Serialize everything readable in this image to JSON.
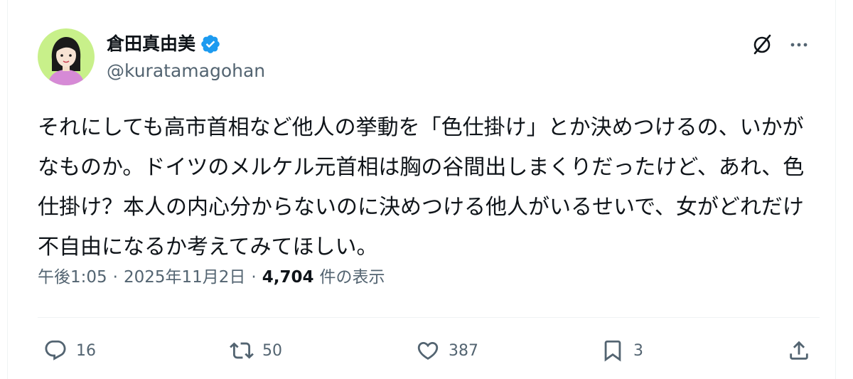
{
  "author": {
    "display_name": "倉田真由美",
    "handle": "@kuratamagohan",
    "verified": true
  },
  "tweet": {
    "text": "それにしても高市首相など他人の挙動を「色仕掛け」とか決めつけるの、いかがなものか。ドイツのメルケル元首相は胸の谷間出しまくりだったけど、あれ、色仕掛け？本人の内心分からないのに決めつける他人がいるせいで、女がどれだけ不自由になるか考えてみてほしい。"
  },
  "meta": {
    "time": "午後1:05",
    "separator": "·",
    "date": "2025年11月2日",
    "views_count": "4,704",
    "views_label": "件の表示"
  },
  "actions": {
    "reply_count": "16",
    "retweet_count": "50",
    "like_count": "387",
    "bookmark_count": "3"
  },
  "icons": {
    "verified": "verified-badge-icon",
    "grok": "grok-icon",
    "more": "more-icon",
    "reply": "reply-icon",
    "retweet": "retweet-icon",
    "like": "heart-icon",
    "bookmark": "bookmark-icon",
    "share": "share-icon"
  },
  "colors": {
    "verified_blue": "#1d9bf0",
    "text_primary": "#0f1419",
    "text_secondary": "#536471",
    "divider": "#eff3f4",
    "avatar_bg": "#c8f08a"
  }
}
